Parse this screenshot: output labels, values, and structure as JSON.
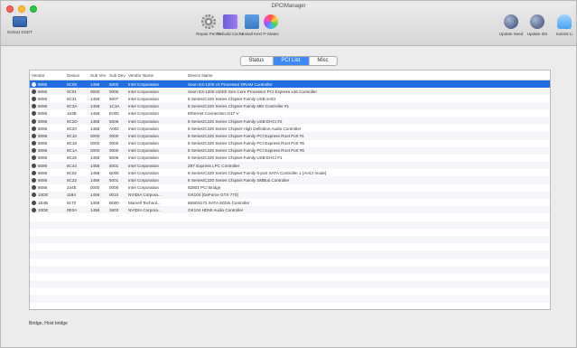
{
  "window": {
    "title": "DPCIManager"
  },
  "toolbar": {
    "left": [
      {
        "label": "Extract DSDT",
        "icon": "monitor-icon"
      }
    ],
    "center": [
      {
        "label": "Repair Perms",
        "icon": "gear-icon"
      },
      {
        "label": "Rebuild Cache",
        "icon": "film-icon"
      },
      {
        "label": "Install Kext",
        "icon": "drive-icon"
      },
      {
        "label": "P-States",
        "icon": "color-wheel-icon"
      }
    ],
    "right": [
      {
        "label": "Update Seed",
        "icon": "globe-icon"
      },
      {
        "label": "Update IDs",
        "icon": "globe-icon"
      },
      {
        "label": "Submit Li",
        "icon": "cloud-icon"
      }
    ]
  },
  "tabs": [
    {
      "label": "Status",
      "active": false
    },
    {
      "label": "PCI List",
      "active": true
    },
    {
      "label": "Misc",
      "active": false
    }
  ],
  "table": {
    "columns": [
      "Vendor",
      "Device",
      "Sub Ven",
      "Sub Dev",
      "Vendor Name",
      "Device Name"
    ],
    "rows": [
      [
        "8086",
        "0C08",
        "1458",
        "5000",
        "Intel Corporation",
        "Xeon E3-1200 v3 Processor DRAM Controller"
      ],
      [
        "8086",
        "0C01",
        "0000",
        "0000",
        "Intel Corporation",
        "Xeon E3-1200 v3/4th Gen Core Processor PCI Express x16 Controller"
      ],
      [
        "8086",
        "8C31",
        "1458",
        "5007",
        "Intel Corporation",
        "8 Series/C220 Series Chipset Family USB xHCI"
      ],
      [
        "8086",
        "8C3A",
        "1458",
        "1C3A",
        "Intel Corporation",
        "8 Series/C220 Series Chipset Family MEI Controller #1"
      ],
      [
        "8086",
        "153B",
        "1458",
        "E000",
        "Intel Corporation",
        "Ethernet Connection I217-V"
      ],
      [
        "8086",
        "8C2D",
        "1458",
        "5006",
        "Intel Corporation",
        "8 Series/C220 Series Chipset Family USB EHCI #2"
      ],
      [
        "8086",
        "8C20",
        "1458",
        "A002",
        "Intel Corporation",
        "8 Series/C220 Series Chipset High Definition Audio Controller"
      ],
      [
        "8086",
        "8C10",
        "0000",
        "0000",
        "Intel Corporation",
        "8 Series/C220 Series Chipset Family PCI Express Root Port #1"
      ],
      [
        "8086",
        "8C18",
        "0000",
        "0000",
        "Intel Corporation",
        "8 Series/C220 Series Chipset Family PCI Express Root Port #5"
      ],
      [
        "8086",
        "8C1A",
        "0000",
        "0000",
        "Intel Corporation",
        "8 Series/C220 Series Chipset Family PCI Express Root Port #6"
      ],
      [
        "8086",
        "8C26",
        "1458",
        "5006",
        "Intel Corporation",
        "8 Series/C220 Series Chipset Family USB EHCI #1"
      ],
      [
        "8086",
        "8C44",
        "1458",
        "5001",
        "Intel Corporation",
        "Z87 Express LPC Controller"
      ],
      [
        "8086",
        "8C02",
        "1458",
        "B005",
        "Intel Corporation",
        "8 Series/C220 Series Chipset Family 6-port SATA Controller 1 [AHCI mode]"
      ],
      [
        "8086",
        "8C22",
        "1458",
        "5001",
        "Intel Corporation",
        "8 Series/C220 Series Chipset Family SMBus Controller"
      ],
      [
        "8086",
        "244E",
        "0000",
        "0000",
        "Intel Corporation",
        "82801 PCI Bridge"
      ],
      [
        "10DE",
        "1184",
        "1458",
        "0010",
        "NVIDIA Corpora...",
        "GK104 [GeForce GTX 770]"
      ],
      [
        "1B4B",
        "9172",
        "1458",
        "B000",
        "Marvell Technol...",
        "88SE9172 SATA 6Gb/s Controller"
      ],
      [
        "10DE",
        "0E0A",
        "1458",
        "3603",
        "NVIDIA Corpora...",
        "GK104 HDMI Audio Controller"
      ]
    ],
    "selected_index": 0
  },
  "status": {
    "text": "Bridge, Host bridge"
  }
}
